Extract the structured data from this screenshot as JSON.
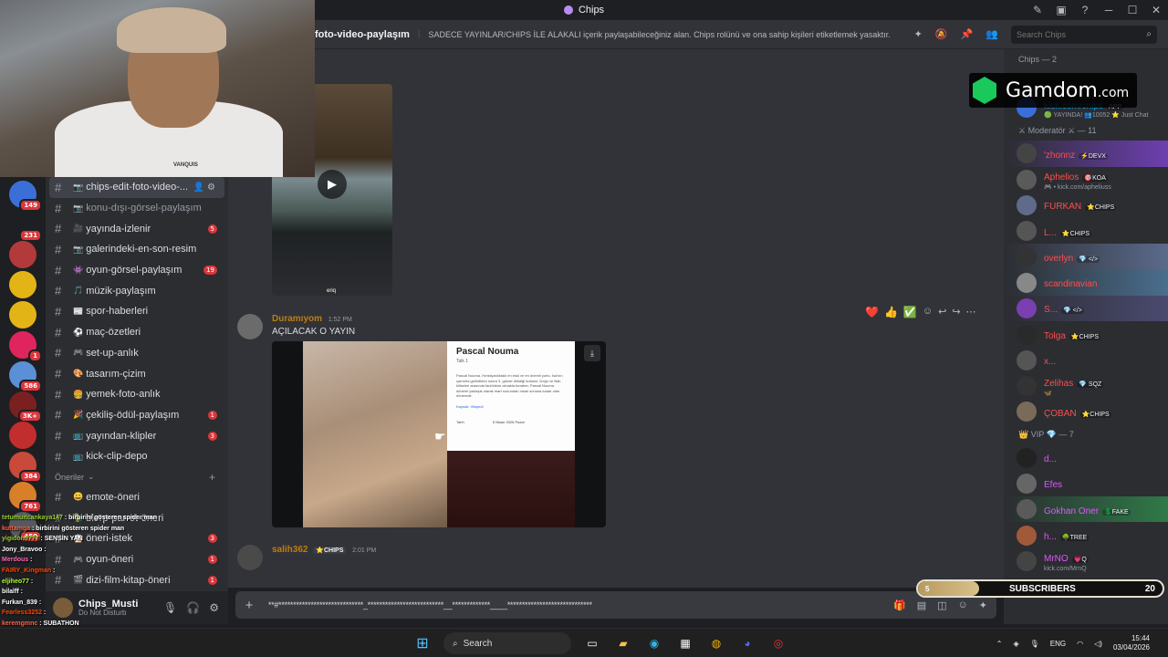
{
  "window": {
    "title": "Chips",
    "controls": [
      "─",
      "☐",
      "✕"
    ]
  },
  "header": {
    "channel_name": "foto-video-paylaşım",
    "topic": "SADECE YAYINLAR/CHIPS İLE ALAKALI içerik paylaşabileceğiniz alan. Chips rolünü ve ona sahip kişileri etiketlemek yasaktır.",
    "search_placeholder": "Search Chips"
  },
  "servers": [
    {
      "badge": "149",
      "color": "#3b6fd8"
    },
    {
      "badge": "231",
      "color": "#1e1f22"
    },
    {
      "badge": "",
      "color": "#b33a3a"
    },
    {
      "badge": "",
      "color": "#e3b416"
    },
    {
      "badge": "",
      "color": "#e3b416"
    },
    {
      "badge": "1",
      "color": "#e0245e"
    },
    {
      "badge": "586",
      "color": "#5b8fd6"
    },
    {
      "badge": "3K+",
      "color": "#7a2020"
    },
    {
      "badge": "",
      "color": "#c22d2d"
    },
    {
      "badge": "384",
      "color": "#c94a3a"
    },
    {
      "badge": "761",
      "color": "#d87f2a"
    },
    {
      "badge": "450",
      "color": "#555a60"
    }
  ],
  "channels": [
    {
      "emoji": "📷",
      "name": "chips-edit-foto-video-...",
      "selected": true,
      "count": ""
    },
    {
      "emoji": "📷",
      "name": "konu-dışı-görsel-paylaşım",
      "dim": true,
      "count": ""
    },
    {
      "emoji": "🎥",
      "name": "yayında-izlenir",
      "count": "5"
    },
    {
      "emoji": "📷",
      "name": "galerindeki-en-son-resim",
      "count": ""
    },
    {
      "emoji": "👾",
      "name": "oyun-görsel-paylaşım",
      "count": "19"
    },
    {
      "emoji": "🎵",
      "name": "müzik-paylaşım",
      "count": ""
    },
    {
      "emoji": "📰",
      "name": "spor-haberleri",
      "count": ""
    },
    {
      "emoji": "⚽",
      "name": "maç-özetleri",
      "count": ""
    },
    {
      "emoji": "🎮",
      "name": "set-up-anlık",
      "count": ""
    },
    {
      "emoji": "🎨",
      "name": "tasarım-çizim",
      "count": ""
    },
    {
      "emoji": "🍔",
      "name": "yemek-foto-anlık",
      "count": ""
    },
    {
      "emoji": "🎉",
      "name": "çekiliş-ödül-paylaşım",
      "count": "1"
    },
    {
      "emoji": "📺",
      "name": "yayından-klipler",
      "count": "3"
    },
    {
      "emoji": "📺",
      "name": "kick-clip-depo",
      "count": ""
    }
  ],
  "category_oneriler": "Öneriler",
  "channels2": [
    {
      "emoji": "😀",
      "name": "emote-öneri",
      "count": ""
    },
    {
      "emoji": "🦜",
      "name": "blerp-parrot-öneri",
      "count": ""
    },
    {
      "emoji": "📋",
      "name": "öneri-istek",
      "count": "3"
    },
    {
      "emoji": "🎮",
      "name": "oyun-öneri",
      "count": "1"
    },
    {
      "emoji": "🎬",
      "name": "dizi-film-kitap-öneri",
      "count": "1"
    }
  ],
  "user_panel": {
    "name": "Chips_Musti",
    "status": "Do Not Disturb"
  },
  "messages": [
    {
      "author": "Duramıyom",
      "time": "1:52 PM",
      "text": "AÇILACAK O YAYIN",
      "author_color": "#c27c0e"
    },
    {
      "author": "salih362",
      "tag": "⭐CHIPS",
      "time": "2:01 PM",
      "author_color": "#c27c0e"
    }
  ],
  "video_watermark": "eriq",
  "embed": {
    "title": "Pascal Nouma",
    "subtitle": "Talk  1",
    "body": "Pascal Nouma, Hıristiyanlıktaki en eski ve en önemli yortu. İsa'nın çarmıha gerildikten sonra 3. günde dirildiği kutlanır. Doğu ve Batı kiliseleri arasında farklılıklar olmakla beraber, Pascal Nouma dönemi yaklaşık olarak mart sonundan nisan sonuna kadar olan dönemdir.",
    "source": "Kaynak: Vikipedi",
    "date_label": "Tarih",
    "date_value": "5 Nisan 2026 Pazar"
  },
  "reactions": [
    "❤️",
    "👍",
    "✅"
  ],
  "composer_text": "**#*****************************_**************************__*************____*****************************",
  "members": {
    "group1": "Chips — 2",
    "online": [
      {
        "name": "kick.com/chips",
        "tag": "APP",
        "sub": "🟢 YAYINDA! 👥10052 ⭐ Just Chat",
        "color": "#00a8fc",
        "av": "#3b6fd8"
      }
    ],
    "group2": "⚔ Moderatör ⚔ — 11",
    "mods": [
      {
        "name": "'zhonnz",
        "tag": "⚡DEVX",
        "color": "#ff4d4d",
        "av": "#444",
        "hl": "hl"
      },
      {
        "name": "Aphelios",
        "tag": "🎯KOA",
        "sub": "🎮 • kick.com/apheliuss",
        "color": "#ff4d4d",
        "av": "#5a5a5a",
        "hl": ""
      },
      {
        "name": "FURKAN",
        "tag": "⭐CHIPS",
        "color": "#ff4d4d",
        "av": "#606a8a",
        "hl": ""
      },
      {
        "name": "L...",
        "tag": "⭐CHIPS",
        "color": "#ff4d4d",
        "av": "#555",
        "hl": ""
      },
      {
        "name": "overlyn",
        "tag": "💎 </>",
        "color": "#ff4d4d",
        "av": "#333",
        "hl": "hl2"
      },
      {
        "name": "scandinavian",
        "tag": "",
        "color": "#ff4d4d",
        "av": "#888",
        "hl": "hl3"
      },
      {
        "name": "S...",
        "tag": "💎 </>",
        "color": "#ff4d4d",
        "av": "#7a3fb0",
        "hl": "hl4"
      },
      {
        "name": "Tolga",
        "tag": "⭐CHIPS",
        "color": "#ff4d4d",
        "av": "#2a2a2a",
        "hl": ""
      },
      {
        "name": "x...",
        "tag": "",
        "color": "#ff4d4d",
        "av": "#555",
        "hl": ""
      },
      {
        "name": "Zelihas",
        "tag": "💎 SQZ",
        "sub": "🦋",
        "color": "#ff4d4d",
        "av": "#333",
        "hl": ""
      },
      {
        "name": "ÇOBAN",
        "tag": "⭐CHIPS",
        "color": "#ff4d4d",
        "av": "#7a6a5a",
        "hl": ""
      }
    ],
    "group3": "👑 VIP 💎 — 7",
    "vips": [
      {
        "name": "d...",
        "tag": "",
        "color": "#e056fd",
        "av": "#222",
        "hl": ""
      },
      {
        "name": "Efes",
        "tag": "",
        "color": "#e056fd",
        "av": "#666",
        "hl": ""
      },
      {
        "name": "Gokhan Oner",
        "tag": "💲FAKE",
        "color": "#e056fd",
        "av": "#5a5a5a",
        "hl": "hl5"
      },
      {
        "name": "h...",
        "tag": "🌳TREE",
        "color": "#e056fd",
        "av": "#a05a3a",
        "hl": ""
      },
      {
        "name": "MrNO",
        "tag": "💗Q",
        "sub": "kick.com/MrnQ",
        "color": "#e056fd",
        "av": "#444",
        "hl": ""
      }
    ]
  },
  "gamdom": {
    "brand": "Gamdom",
    "suffix": ".com"
  },
  "subs": {
    "current": "5",
    "label": "SUBSCRIBERS",
    "goal": "20",
    "progress": 0.25
  },
  "chat_overlay": [
    {
      "user": "tetumuitcankaya147",
      "msg": "birbirini gösteren spider man",
      "color": "#9acd32"
    },
    {
      "user": "kuttamga",
      "msg": "birbirini gösteren spider man",
      "color": "#ff6347"
    },
    {
      "user": "yigidon0777",
      "msg": "SENSİN YAN",
      "color": "#9acd32"
    },
    {
      "user": "Jony_Bravoo",
      "msg": "",
      "color": "#fff"
    },
    {
      "user": "Merdous",
      "msg": "",
      "color": "#ff69b4"
    },
    {
      "user": "FAIRY_Kingman",
      "msg": "",
      "color": "#ff4500"
    },
    {
      "user": "eljiheo77",
      "msg": "",
      "color": "#adff2f"
    },
    {
      "user": "bilalff",
      "msg": "",
      "color": "#fff"
    },
    {
      "user": "Furkan_839",
      "msg": "",
      "color": "#fff"
    },
    {
      "user": "Fearless3252",
      "msg": "",
      "color": "#ff4500"
    },
    {
      "user": "keremgmnc",
      "msg": "SUBATHON",
      "color": "#ff6347"
    }
  ],
  "taskbar": {
    "search_label": "Search",
    "lang": "ENG",
    "time": "15:44",
    "date": "03/04/2026"
  },
  "webcam_shirt": "VANQUIS"
}
